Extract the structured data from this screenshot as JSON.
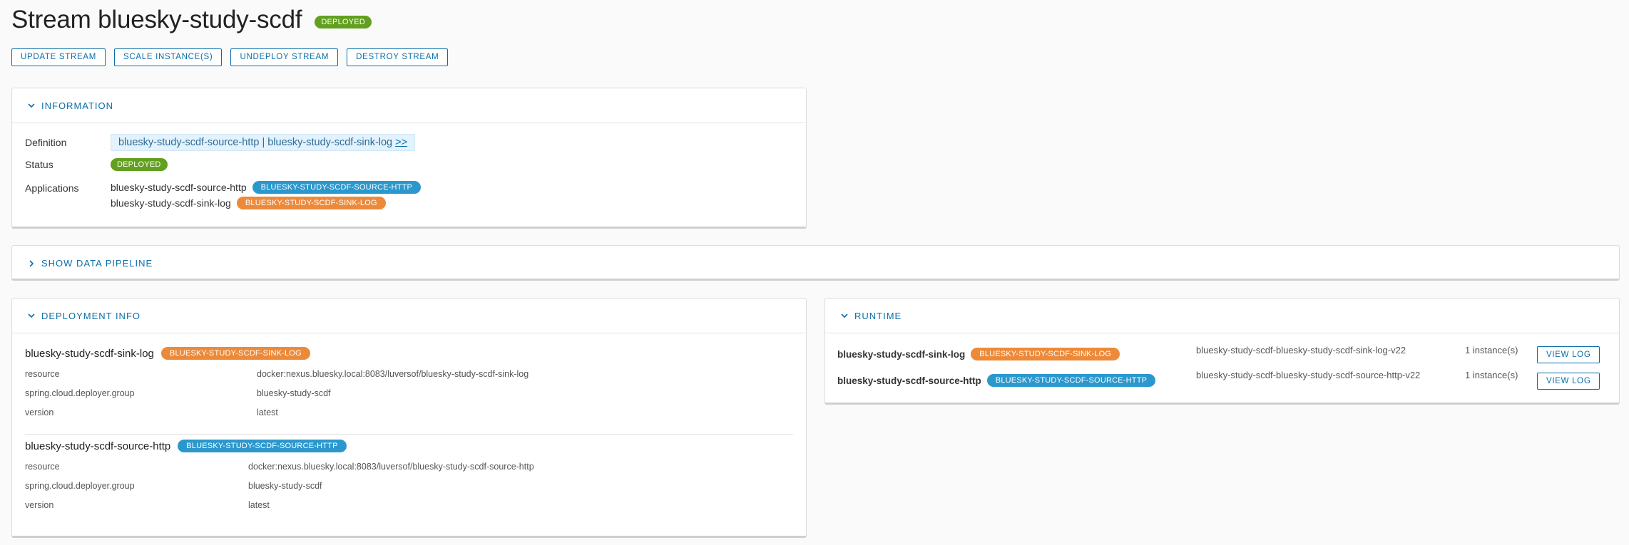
{
  "page": {
    "title": "Stream bluesky-study-scdf",
    "status": "DEPLOYED"
  },
  "actions": {
    "update": "UPDATE STREAM",
    "scale": "SCALE INSTANCE(S)",
    "undeploy": "UNDEPLOY STREAM",
    "destroy": "DESTROY STREAM"
  },
  "information": {
    "title": "INFORMATION",
    "definition_label": "Definition",
    "definition_text": "bluesky-study-scdf-source-http | bluesky-study-scdf-sink-log",
    "definition_more": ">>",
    "status_label": "Status",
    "status_value": "DEPLOYED",
    "applications_label": "Applications",
    "applications": [
      {
        "name": "bluesky-study-scdf-source-http",
        "badge": "BLUESKY-STUDY-SCDF-SOURCE-HTTP"
      },
      {
        "name": "bluesky-study-scdf-sink-log",
        "badge": "BLUESKY-STUDY-SCDF-SINK-LOG"
      }
    ]
  },
  "pipeline": {
    "title": "SHOW DATA PIPELINE"
  },
  "deployment": {
    "title": "DEPLOYMENT INFO",
    "blocks": [
      {
        "name": "bluesky-study-scdf-sink-log",
        "badge": "BLUESKY-STUDY-SCDF-SINK-LOG",
        "rows": [
          {
            "key": "resource",
            "value": "docker:nexus.bluesky.local:8083/luversof/bluesky-study-scdf-sink-log"
          },
          {
            "key": "spring.cloud.deployer.group",
            "value": "bluesky-study-scdf"
          },
          {
            "key": "version",
            "value": "latest"
          }
        ]
      },
      {
        "name": "bluesky-study-scdf-source-http",
        "badge": "BLUESKY-STUDY-SCDF-SOURCE-HTTP",
        "rows": [
          {
            "key": "resource",
            "value": "docker:nexus.bluesky.local:8083/luversof/bluesky-study-scdf-source-http"
          },
          {
            "key": "spring.cloud.deployer.group",
            "value": "bluesky-study-scdf"
          },
          {
            "key": "version",
            "value": "latest"
          }
        ]
      }
    ]
  },
  "runtime": {
    "title": "RUNTIME",
    "rows": [
      {
        "name": "bluesky-study-scdf-sink-log",
        "badge": "BLUESKY-STUDY-SCDF-SINK-LOG",
        "id": "bluesky-study-scdf-bluesky-study-scdf-sink-log-v22",
        "instances": "1 instance(s)",
        "button": "VIEW LOG"
      },
      {
        "name": "bluesky-study-scdf-source-http",
        "badge": "BLUESKY-STUDY-SCDF-SOURCE-HTTP",
        "id": "bluesky-study-scdf-bluesky-study-scdf-source-http-v22",
        "instances": "1 instance(s)",
        "button": "VIEW LOG"
      }
    ]
  },
  "colors": {
    "accent": "#0a6fa8",
    "deployed": "#62a01f",
    "source_badge": "#2b98cd",
    "sink_badge": "#ec8a3a"
  },
  "icons": {
    "expanded": "chevron-down-icon",
    "collapsed": "chevron-right-icon"
  }
}
